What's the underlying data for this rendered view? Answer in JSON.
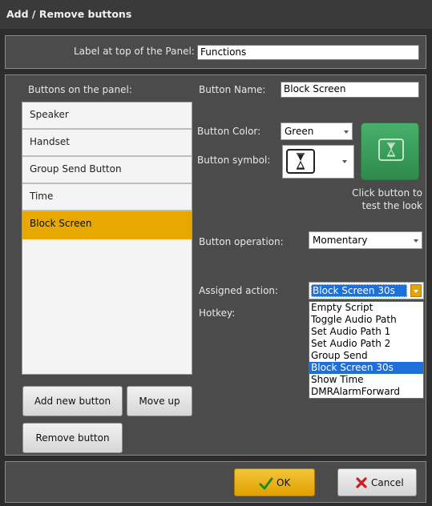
{
  "window": {
    "title": "Add / Remove buttons"
  },
  "panel_label": {
    "label": "Label at top of the Panel:",
    "value": "Functions"
  },
  "buttons_list": {
    "label": "Buttons on the panel:",
    "items": [
      "Speaker",
      "Handset",
      "Group Send Button",
      "Time",
      "Block Screen"
    ],
    "selected": "Block Screen"
  },
  "left_buttons": {
    "add": "Add new button",
    "move_up": "Move up",
    "remove": "Remove button"
  },
  "button_name": {
    "label": "Button Name:",
    "value": "Block Screen"
  },
  "button_color": {
    "label": "Button Color:",
    "value": "Green"
  },
  "button_symbol": {
    "label": "Button symbol:",
    "icon": "hourglass-icon"
  },
  "preview": {
    "icon": "hourglass-icon",
    "color": "#3aa05a",
    "caption_line1": "Click button to",
    "caption_line2": "test the look"
  },
  "button_operation": {
    "label": "Button operation:",
    "value": "Momentary"
  },
  "assigned_action": {
    "label": "Assigned action:",
    "value": "Block Screen 30s",
    "options": [
      "Empty Script",
      "Toggle Audio Path",
      "Set Audio Path 1",
      "Set Audio Path 2",
      "Group Send",
      "Block Screen 30s",
      "Show Time",
      "DMRAlarmForward"
    ],
    "selected": "Block Screen 30s"
  },
  "hotkey": {
    "label": "Hotkey:"
  },
  "dialog_buttons": {
    "ok": "OK",
    "cancel": "Cancel"
  },
  "colors": {
    "accent": "#e8a800",
    "selection": "#1e6fd9",
    "background": "#2d2d2d",
    "panel": "#4b4b4b"
  }
}
